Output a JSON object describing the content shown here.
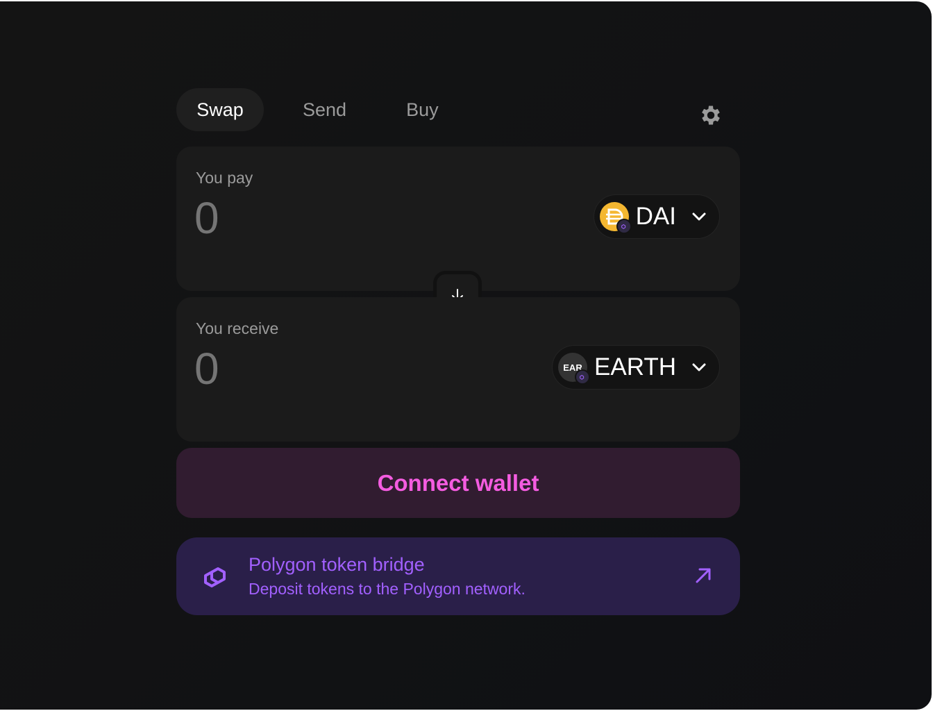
{
  "tabs": [
    {
      "label": "Swap",
      "active": true
    },
    {
      "label": "Send",
      "active": false
    },
    {
      "label": "Buy",
      "active": false
    }
  ],
  "settings_icon": "gear-icon",
  "pay": {
    "label": "You pay",
    "amount": "0",
    "token": {
      "symbol": "DAI",
      "icon": "dai-token-icon",
      "color": "#f4b731"
    }
  },
  "receive": {
    "label": "You receive",
    "amount": "0",
    "token": {
      "symbol": "EARTH",
      "icon_text": "EAR",
      "icon": "earth-token-icon"
    }
  },
  "switch_icon": "arrow-down-icon",
  "connect_wallet": {
    "label": "Connect wallet",
    "color": "#f45ce0",
    "background": "#311c30"
  },
  "bridge_banner": {
    "title": "Polygon token bridge",
    "subtitle": "Deposit tokens to the Polygon network.",
    "icon": "polygon-logo-icon",
    "link_icon": "arrow-up-right-icon",
    "color": "#a260ff",
    "background": "#2a1f49"
  },
  "colors": {
    "background": "#131313",
    "panel": "#1b1b1b",
    "muted_text": "#9b9b9b"
  }
}
